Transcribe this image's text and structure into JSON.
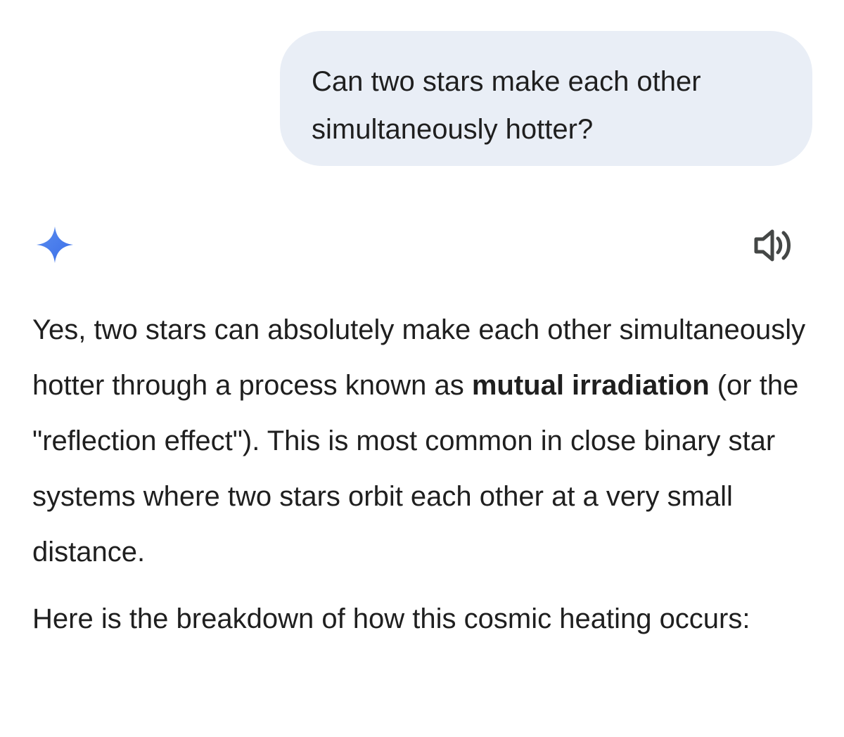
{
  "user_message": {
    "text": "Can two stars make each other simultaneously hotter?"
  },
  "icons": {
    "assistant": "sparkle-icon",
    "read_aloud": "speaker-icon",
    "accent_color": "#4a7cf0"
  },
  "response": {
    "paragraph_1": {
      "intro": "Yes, two stars can absolutely make each other simultaneously hotter through a process known as ",
      "bold_term": "mutual irradiation",
      "rest": " (or the \"reflection effect\"). This is most common in close binary star systems where two stars orbit each other at a very small distance."
    },
    "paragraph_2": "Here is the breakdown of how this cosmic heating occurs:"
  }
}
